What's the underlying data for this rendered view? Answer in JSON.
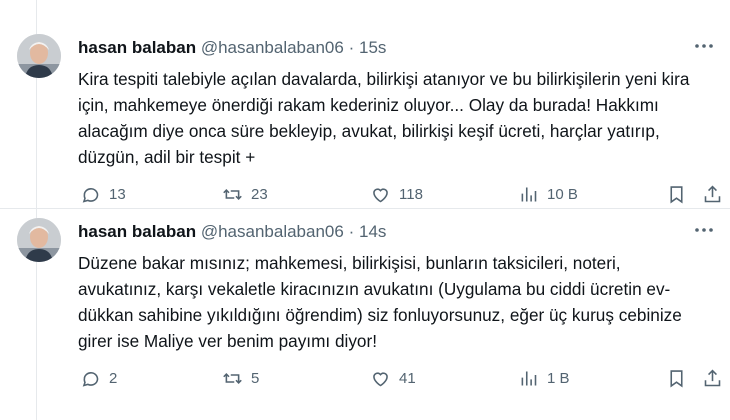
{
  "tweets": [
    {
      "name": "hasan balaban",
      "handle": "@hasanbalaban06",
      "separator": "·",
      "time": "15s",
      "text": "Kira tespiti talebiyle açılan davalarda, bilirkişi atanıyor ve bu bilirkişilerin yeni kira için, mahkemeye önerdiği rakam kederiniz oluyor... Olay  da burada! Hakkımı alacağım diye onca süre bekleyip, avukat, bilirkişi keşif ücreti, harçlar yatırıp, düzgün, adil bir tespit +",
      "replies": "13",
      "reposts": "23",
      "likes": "118",
      "views": "10 B"
    },
    {
      "name": "hasan balaban",
      "handle": "@hasanbalaban06",
      "separator": "·",
      "time": "14s",
      "text": "Düzene bakar mısınız; mahkemesi, bilirkişisi, bunların taksicileri, noteri, avukatınız, karşı vekaletle kiracınızın avukatını (Uygulama bu ciddi  ücretin ev-dükkan sahibine yıkıldığını öğrendim) siz fonluyorsunuz, eğer üç kuruş cebinize girer ise Maliye ver benim payımı diyor!",
      "replies": "2",
      "reposts": "5",
      "likes": "41",
      "views": "1 B"
    }
  ],
  "icons": {
    "reply": "speech-bubble-icon",
    "repost": "repost-arrows-icon",
    "like": "heart-icon",
    "views": "bar-chart-icon",
    "bookmark": "bookmark-icon",
    "share": "share-upload-icon",
    "more": "more-dots-icon"
  },
  "colors": {
    "text": "#0f1419",
    "secondary": "#536471",
    "divider": "#e6e9ec"
  }
}
